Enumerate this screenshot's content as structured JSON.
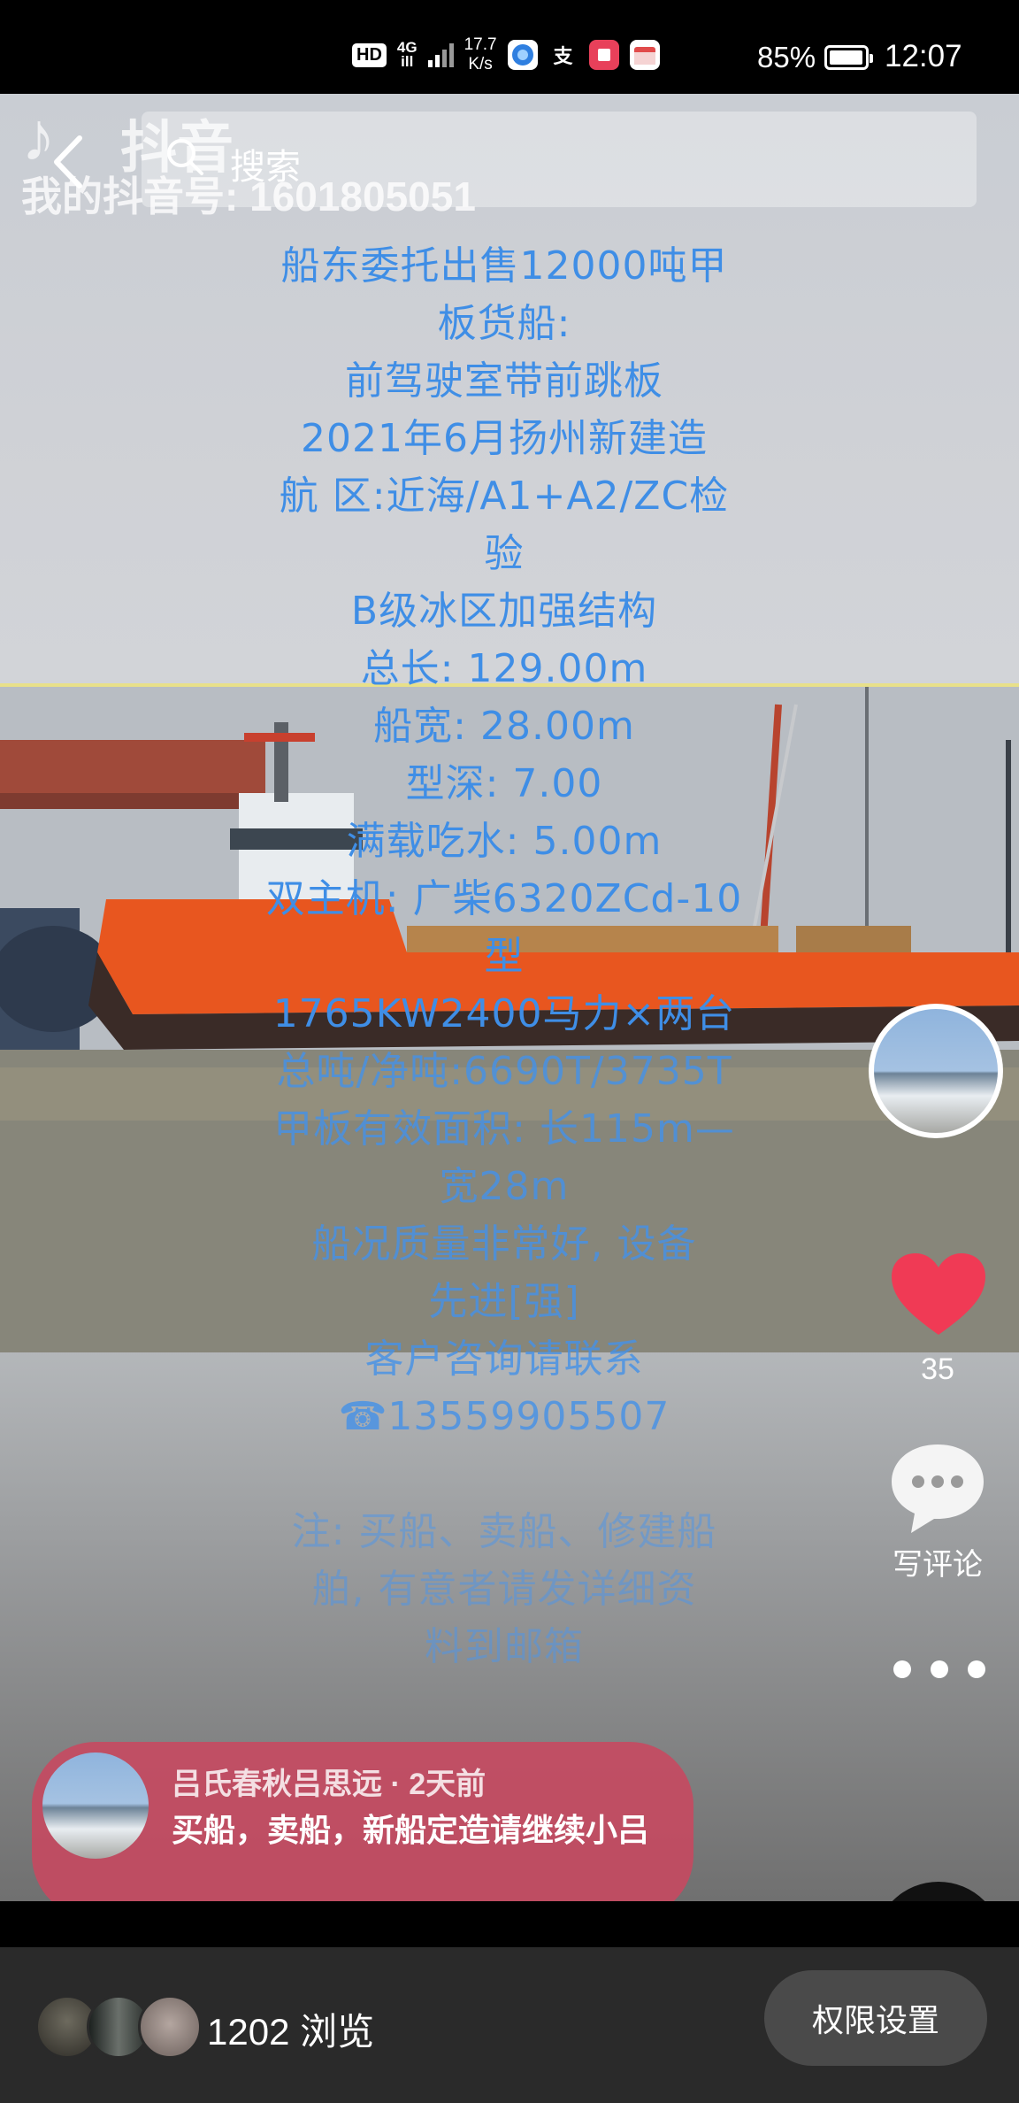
{
  "status_bar": {
    "hd": "HD",
    "network_top": "4G",
    "network_bottom": "ill",
    "speed_value": "17.7",
    "speed_unit": "K/s",
    "app_icons": [
      "browser-icon",
      "alipay-icon",
      "notes-icon",
      "calendar-icon"
    ],
    "alipay_glyph": "支",
    "battery": "85%",
    "battery_level": 0.85,
    "time": "12:07"
  },
  "watermark": {
    "brand": "抖音",
    "account": "我的抖音号: 1601805051"
  },
  "search": {
    "placeholder": "搜索"
  },
  "caption": {
    "lines": [
      "船东委托出售12000吨甲",
      "板货船:",
      "前驾驶室带前跳板",
      "2021年6月扬州新建造",
      "航   区:近海/A1+A2/ZC检",
      "验",
      "B级冰区加强结构",
      "总长: 129.00m",
      "船宽: 28.00m",
      "型深: 7.00",
      "满载吃水: 5.00m",
      "双主机: 广柴6320ZCd-10",
      "型",
      "1765KW2400马力×两台",
      "总吨/净吨:6690T/3735T",
      "甲板有效面积: 长115m—",
      "宽28m",
      "船况质量非常好, 设备",
      "先进[强]",
      "客户咨询请联系",
      "☎13559905507",
      "",
      "注: 买船、卖船、修建船",
      "舶, 有意者请发详细资",
      "料到邮箱"
    ]
  },
  "actions": {
    "like_count": "35",
    "comment_label": "写评论"
  },
  "comment_bubble": {
    "meta": "吕氏春秋吕思远 · 2天前",
    "text": "买船，卖船，新船定造请继续小吕"
  },
  "bottom_bar": {
    "views": "1202 浏览",
    "permission_button": "权限设置"
  },
  "colors": {
    "caption_blue": "#3f8ee6",
    "heart_red": "#f03a55",
    "bubble_red": "#c84860",
    "hull_orange": "#e8561f",
    "bottom_bar": "#2a2a2a"
  }
}
